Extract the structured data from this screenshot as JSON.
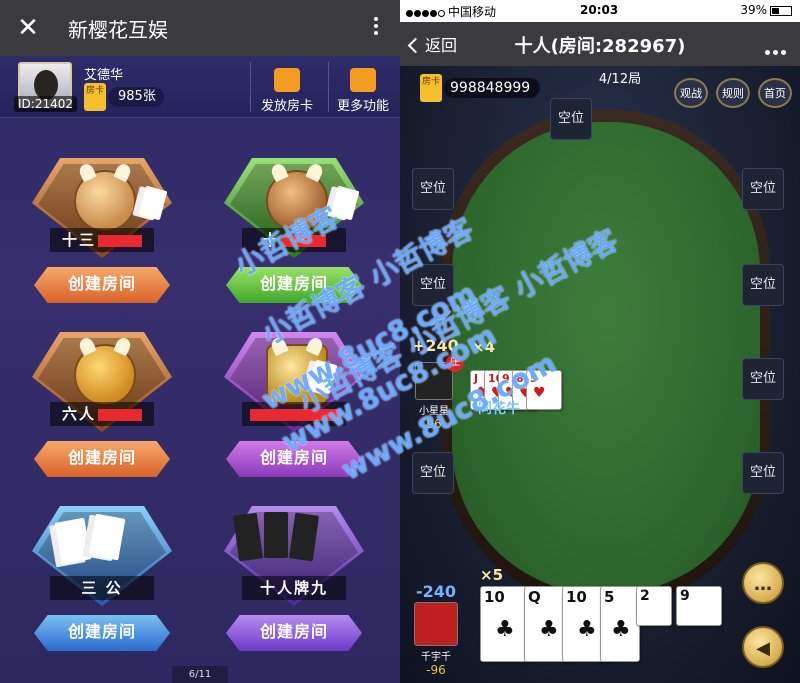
{
  "left": {
    "topbar": {
      "close_glyph": "✕",
      "title": "新樱花互娱"
    },
    "user": {
      "name": "艾德华",
      "id_label": "ID:21402",
      "card_label": "房卡",
      "card_count": "985张"
    },
    "actions": [
      {
        "label": "发放房卡",
        "icon": "gift-icon"
      },
      {
        "label": "更多功能",
        "icon": "user-card-icon"
      }
    ],
    "games": [
      {
        "name": "十三",
        "button": "创建房间",
        "color": "orange"
      },
      {
        "name": "十",
        "button": "创建房间",
        "color": "green"
      },
      {
        "name": "六人",
        "button": "创建房间",
        "color": "orange"
      },
      {
        "name": "",
        "button": "创建房间",
        "color": "purple"
      },
      {
        "name": "三 公",
        "button": "创建房间",
        "color": "blue"
      },
      {
        "name": "十人牌九",
        "button": "创建房间",
        "color": "violet"
      }
    ],
    "page_indicator": "6/11"
  },
  "right": {
    "status": {
      "carrier": "中国移动",
      "time": "20:03",
      "battery": "39%"
    },
    "nav": {
      "back": "返回",
      "title": "十人(房间:282967)"
    },
    "card_label": "房卡",
    "card_count": "998848999",
    "round": "4/12局",
    "buttons": [
      "观战",
      "规则",
      "首页"
    ],
    "seat_label": "空位",
    "player1": {
      "name": "小星星",
      "score": "96",
      "delta": "+240",
      "mult": "×4",
      "banker": "庄",
      "hand": "同花牛",
      "cards": [
        {
          "rank": "J",
          "suit": "♥"
        },
        {
          "rank": "10",
          "suit": "♥"
        },
        {
          "rank": "9",
          "suit": "♥"
        },
        {
          "rank": "8",
          "suit": "♥"
        },
        {
          "rank": "5",
          "suit": "♥"
        }
      ]
    },
    "player2": {
      "name": "千宇千",
      "score": "-96",
      "delta": "-240",
      "mult": "×5",
      "cards": [
        {
          "rank": "10",
          "suit": "♣"
        },
        {
          "rank": "Q",
          "suit": "♣"
        },
        {
          "rank": "10",
          "suit": "♣"
        },
        {
          "rank": "5",
          "suit": "♣"
        },
        {
          "rank": "2",
          "suit": ""
        },
        {
          "rank": "9",
          "suit": ""
        }
      ]
    }
  },
  "watermarks": [
    "小哲博客",
    "小哲博客 小哲博客",
    "小哲博客 小哲博客 小哲博客",
    "www.8uc8.com",
    "www.8uc8.com",
    "www.8uc8.com"
  ],
  "colors": {
    "accent_gold": "#f4c12c",
    "felt_green": "#2c652b",
    "nav_gray": "#3b3b3f"
  }
}
